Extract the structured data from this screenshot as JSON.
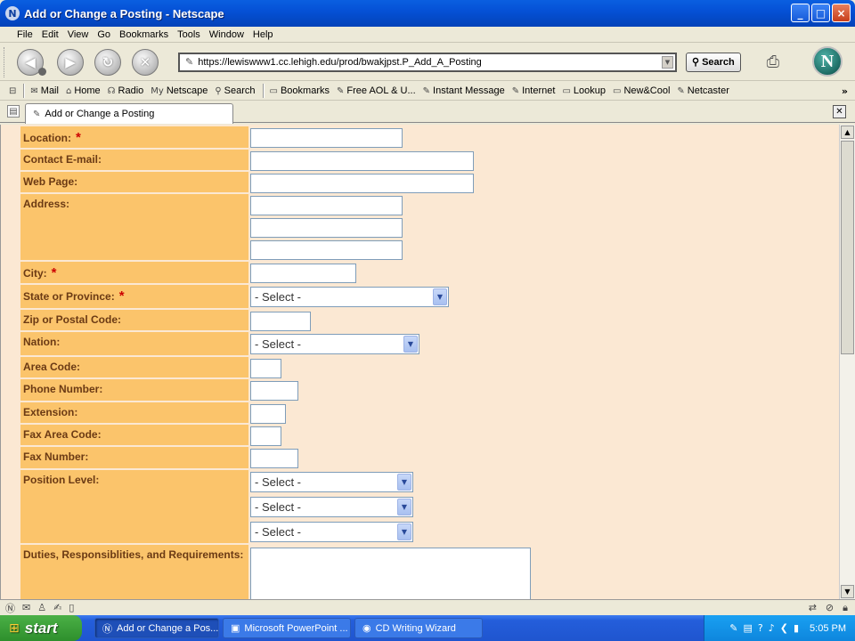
{
  "window": {
    "title": "Add or Change a Posting - Netscape",
    "app_icon": "netscape-icon",
    "controls": [
      "_",
      "□",
      "×"
    ]
  },
  "menu": [
    "File",
    "Edit",
    "View",
    "Go",
    "Bookmarks",
    "Tools",
    "Window",
    "Help"
  ],
  "nav": {
    "url": "https://lewiswww1.cc.lehigh.edu/prod/bwakjpst.P_Add_A_Posting",
    "search_label": "Search"
  },
  "personal_toolbar": [
    {
      "icon": "✉",
      "label": "Mail"
    },
    {
      "icon": "⌂",
      "label": "Home"
    },
    {
      "icon": "☊",
      "label": "Radio"
    },
    {
      "icon": "My",
      "label": "Netscape"
    },
    {
      "icon": "⚲",
      "label": "Search"
    },
    {
      "icon": "▭",
      "label": "Bookmarks"
    },
    {
      "icon": "✎",
      "label": "Free AOL & U..."
    },
    {
      "icon": "✎",
      "label": "Instant Message"
    },
    {
      "icon": "✎",
      "label": "Internet"
    },
    {
      "icon": "▭",
      "label": "Lookup"
    },
    {
      "icon": "▭",
      "label": "New&Cool"
    },
    {
      "icon": "✎",
      "label": "Netcaster"
    }
  ],
  "tab": {
    "label": "Add or Change a Posting"
  },
  "form": {
    "required_mark": "*",
    "location": "Location:",
    "contact_email": "Contact E-mail:",
    "web_page": "Web Page:",
    "address": "Address:",
    "city": "City:",
    "state": "State or Province:",
    "state_select": "- Select -",
    "zip": "Zip or Postal Code:",
    "nation": "Nation:",
    "nation_select": "- Select -",
    "area_code": "Area Code:",
    "phone": "Phone Number:",
    "extension": "Extension:",
    "fax_area": "Fax Area Code:",
    "fax_number": "Fax Number:",
    "position_level": "Position Level:",
    "position_selects": [
      "- Select -",
      "- Select -",
      "- Select -"
    ],
    "duties": "Duties, Responsiblities, and Requirements:"
  },
  "taskbar": {
    "start": "start",
    "tasks": [
      {
        "label": "Add or Change a Pos...",
        "active": true
      },
      {
        "label": "Microsoft PowerPoint ...",
        "active": false
      },
      {
        "label": "CD Writing Wizard",
        "active": false
      }
    ],
    "clock": "5:05 PM"
  },
  "colors": {
    "label_bg": "#fbc46b",
    "page_bg": "#fbe8d3",
    "label_text": "#6b3a14",
    "required": "#cc0000"
  }
}
